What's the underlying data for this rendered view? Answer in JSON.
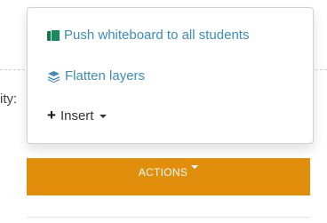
{
  "background": {
    "side_label": "ity:",
    "actions_button_label": "ACTIONS",
    "actions_button_color": "#e08e0b"
  },
  "menu": {
    "items": [
      {
        "label": "Push whiteboard to all students",
        "icon": "copy-icon",
        "color": "#3c8dbc"
      },
      {
        "label": "Flatten layers",
        "icon": "layers-icon",
        "color": "#3c8dbc"
      },
      {
        "label": "Insert",
        "icon": "plus-icon",
        "has_submenu": true,
        "color": "#333333"
      }
    ]
  }
}
